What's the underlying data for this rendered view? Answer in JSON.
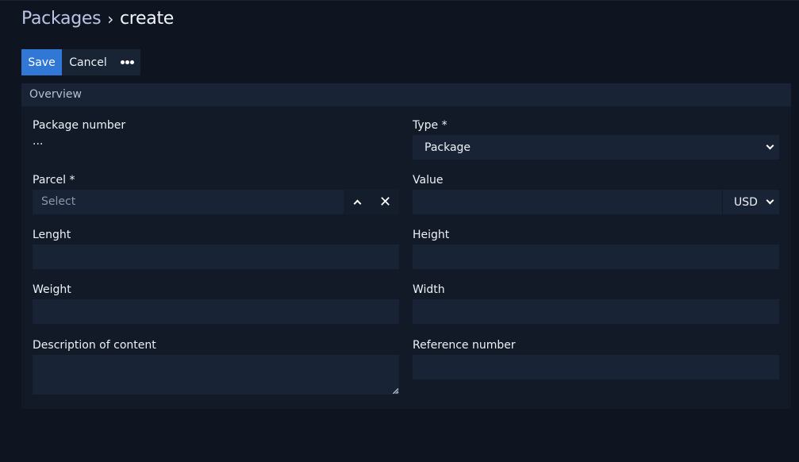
{
  "breadcrumb": {
    "parent": "Packages",
    "separator": "›",
    "current": "create"
  },
  "toolbar": {
    "save_label": "Save",
    "cancel_label": "Cancel",
    "more_icon": "ellipsis-icon"
  },
  "card": {
    "title": "Overview",
    "fields": {
      "package_number": {
        "label": "Package number",
        "value": "..."
      },
      "type": {
        "label": "Type *",
        "selected": "Package"
      },
      "parcel": {
        "label": "Parcel *",
        "placeholder": "Select"
      },
      "value": {
        "label": "Value",
        "value": "",
        "currency": "USD"
      },
      "length": {
        "label": "Lenght",
        "value": ""
      },
      "height": {
        "label": "Height",
        "value": ""
      },
      "weight": {
        "label": "Weight",
        "value": ""
      },
      "width": {
        "label": "Width",
        "value": ""
      },
      "description": {
        "label": "Description of content",
        "value": ""
      },
      "reference_number": {
        "label": "Reference number",
        "value": ""
      }
    }
  },
  "colors": {
    "accent": "#3178d6",
    "background": "#0f1520",
    "card": "#121a27",
    "input": "#182335"
  }
}
